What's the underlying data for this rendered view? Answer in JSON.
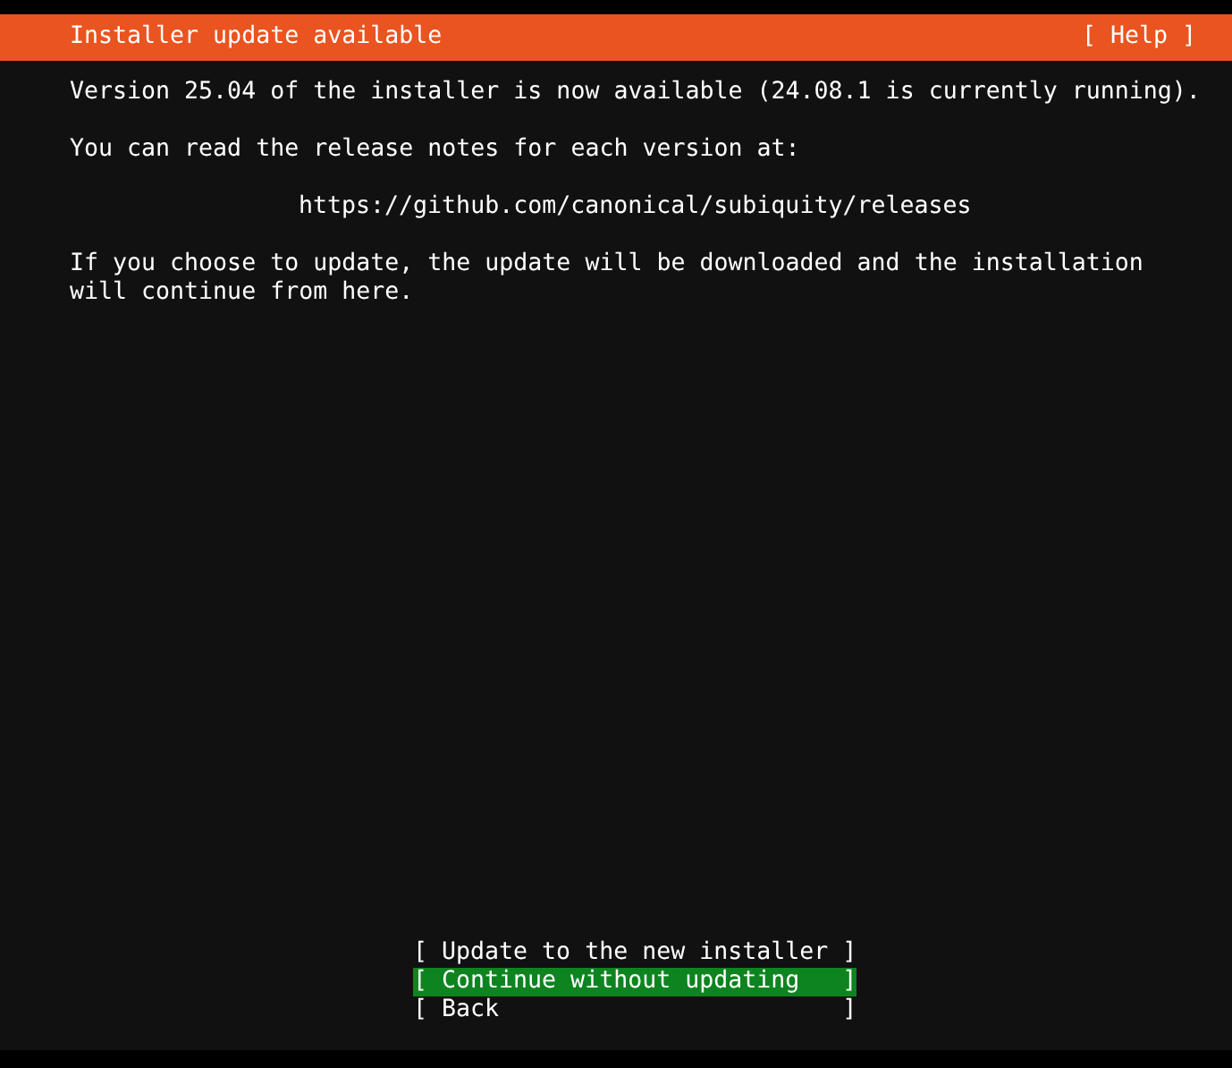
{
  "header": {
    "title": "Installer update available",
    "help": "[ Help ]"
  },
  "paragraphs": [
    {
      "kind": "text",
      "text": "Version 25.04 of the installer is now available (24.08.1 is currently running)."
    },
    {
      "kind": "text",
      "text": "You can read the release notes for each version at:"
    },
    {
      "kind": "link",
      "text": "https://github.com/canonical/subiquity/releases"
    },
    {
      "kind": "text",
      "text": "If you choose to update, the update will be downloaded and the installation will continue from here."
    }
  ],
  "buttons": [
    {
      "label": "[ Update to the new installer ]",
      "selected": false
    },
    {
      "label": "[ Continue without updating   ]",
      "selected": true
    },
    {
      "label": "[ Back                        ]",
      "selected": false
    }
  ]
}
